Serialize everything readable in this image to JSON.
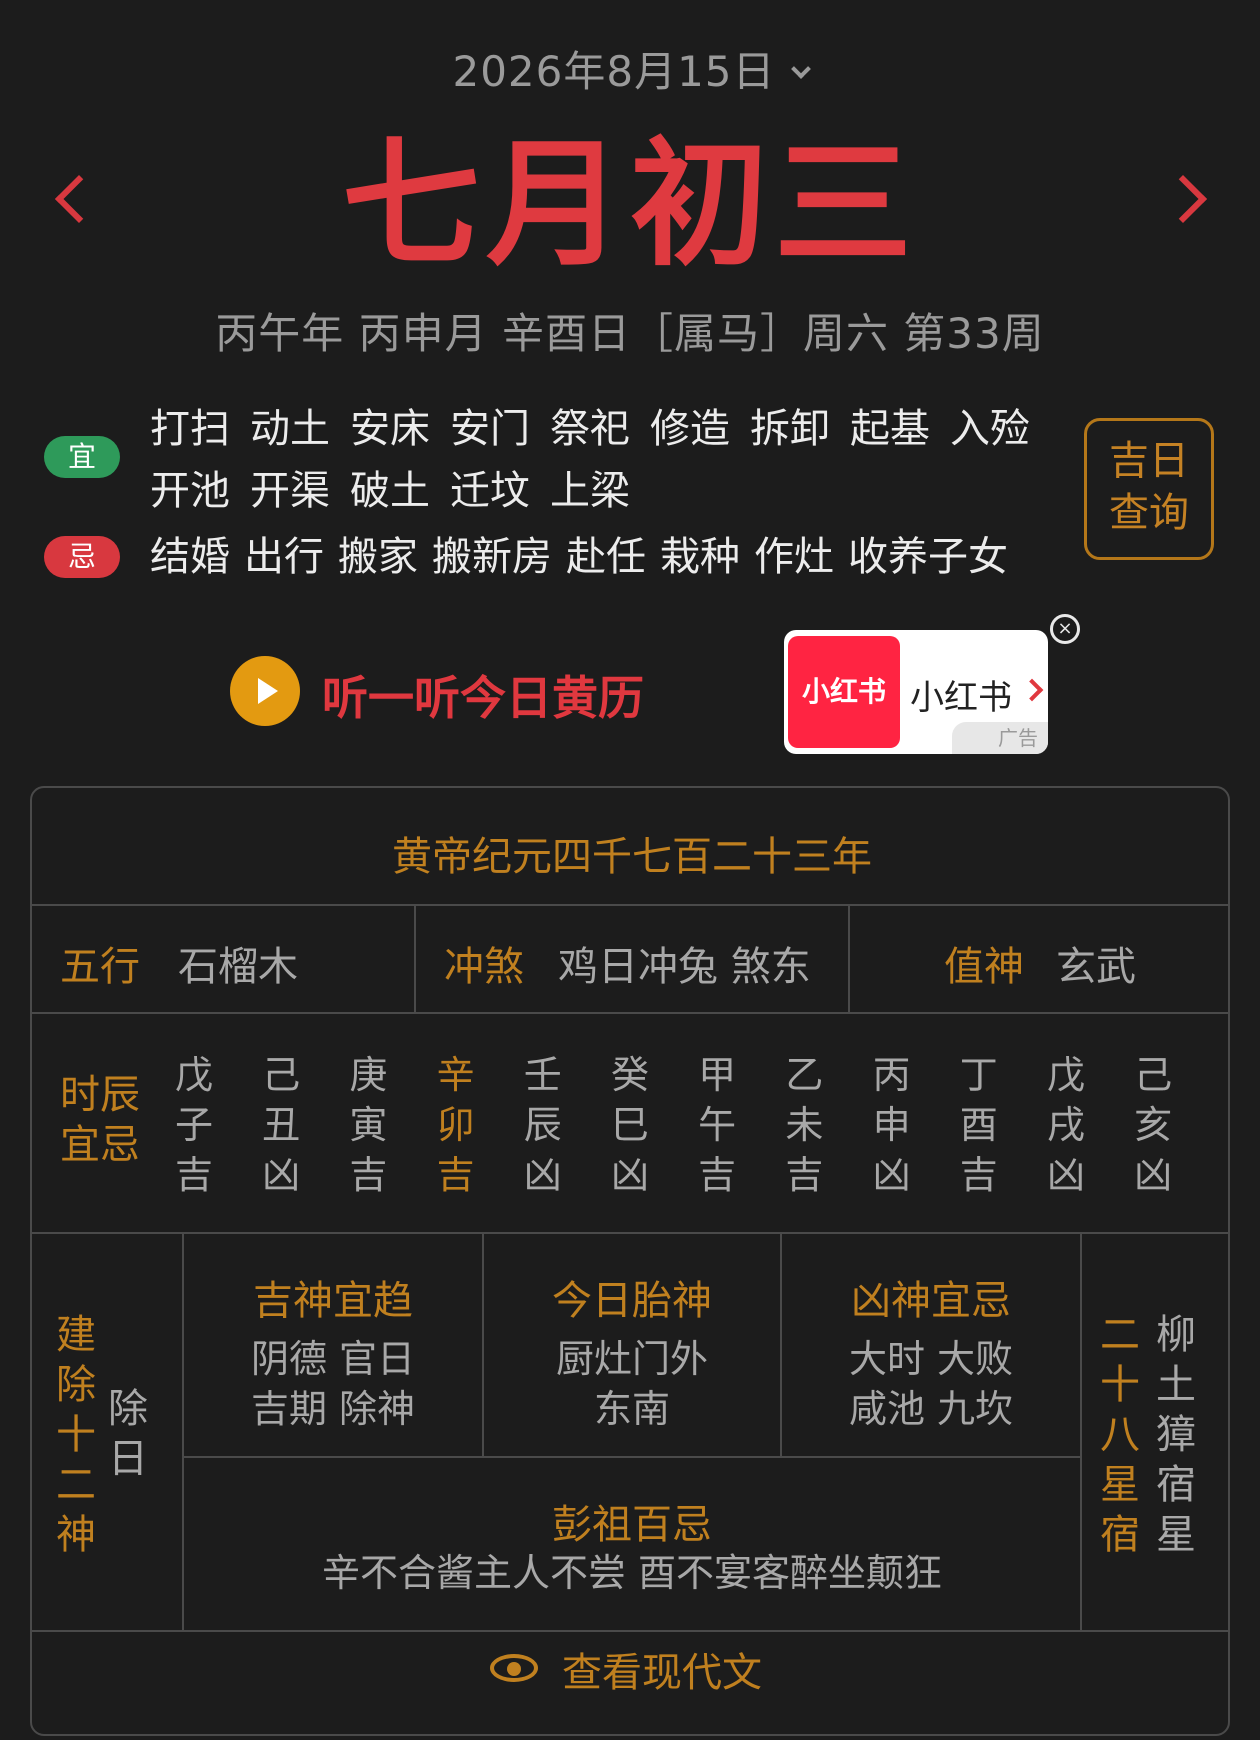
{
  "header": {
    "date_text": "2026年8月15日",
    "lunar_title": "七月初三",
    "ganzhi_line": "丙午年 丙申月 辛酉日［属马］周六  第33周"
  },
  "yi": {
    "label": "宜",
    "items": [
      "打扫",
      "动土",
      "安床",
      "安门",
      "祭祀",
      "修造",
      "拆卸",
      "起基",
      "入殓",
      "开池",
      "开渠",
      "破土",
      "迁坟",
      "上梁"
    ]
  },
  "ji": {
    "label": "忌",
    "items": [
      "结婚",
      "出行",
      "搬家",
      "搬新房",
      "赴任",
      "栽种",
      "作灶",
      "收养子女"
    ]
  },
  "jiri_button": {
    "line1": "吉日",
    "line2": "查询"
  },
  "listen": {
    "label": "听一听今日黄历"
  },
  "ad": {
    "logo_text": "小红书",
    "name": "小红书",
    "badge": "广告",
    "close": "×"
  },
  "panel": {
    "era": "黄帝纪元四千七百二十三年",
    "wuxing": {
      "label": "五行",
      "value": "石榴木"
    },
    "chongsha": {
      "label": "冲煞",
      "value": "鸡日冲兔 煞东"
    },
    "zhishen": {
      "label": "值神",
      "value": "玄武"
    },
    "hours": {
      "label_line1": "时辰",
      "label_line2": "宜忌",
      "columns": [
        {
          "stem": "戊",
          "branch": "子",
          "luck": "吉"
        },
        {
          "stem": "己",
          "branch": "丑",
          "luck": "凶"
        },
        {
          "stem": "庚",
          "branch": "寅",
          "luck": "吉"
        },
        {
          "stem": "辛",
          "branch": "卯",
          "luck": "吉"
        },
        {
          "stem": "壬",
          "branch": "辰",
          "luck": "凶"
        },
        {
          "stem": "癸",
          "branch": "巳",
          "luck": "凶"
        },
        {
          "stem": "甲",
          "branch": "午",
          "luck": "吉"
        },
        {
          "stem": "乙",
          "branch": "未",
          "luck": "吉"
        },
        {
          "stem": "丙",
          "branch": "申",
          "luck": "凶"
        },
        {
          "stem": "丁",
          "branch": "酉",
          "luck": "吉"
        },
        {
          "stem": "戊",
          "branch": "戌",
          "luck": "凶"
        },
        {
          "stem": "己",
          "branch": "亥",
          "luck": "凶"
        }
      ],
      "active_index": 3
    },
    "jianchu": {
      "label": [
        "建",
        "除",
        "十",
        "二",
        "神"
      ],
      "value": [
        "除",
        "日"
      ]
    },
    "jishen": {
      "title": "吉神宜趋",
      "line1": "阴德 官日",
      "line2": "吉期 除神"
    },
    "taishen": {
      "title": "今日胎神",
      "line1": "厨灶门外",
      "line2": "东南"
    },
    "xiongshen": {
      "title": "凶神宜忌",
      "line1": "大时 大败",
      "line2": "咸池 九坎"
    },
    "xingxiu": {
      "label": [
        "二",
        "十",
        "八",
        "星",
        "宿"
      ],
      "value": [
        "柳",
        "土",
        "獐",
        "宿",
        "星"
      ]
    },
    "pengzu": {
      "title": "彭祖百忌",
      "text": "辛不合酱主人不尝 酉不宴客醉坐颠狂"
    },
    "modern_link": "查看现代文"
  }
}
